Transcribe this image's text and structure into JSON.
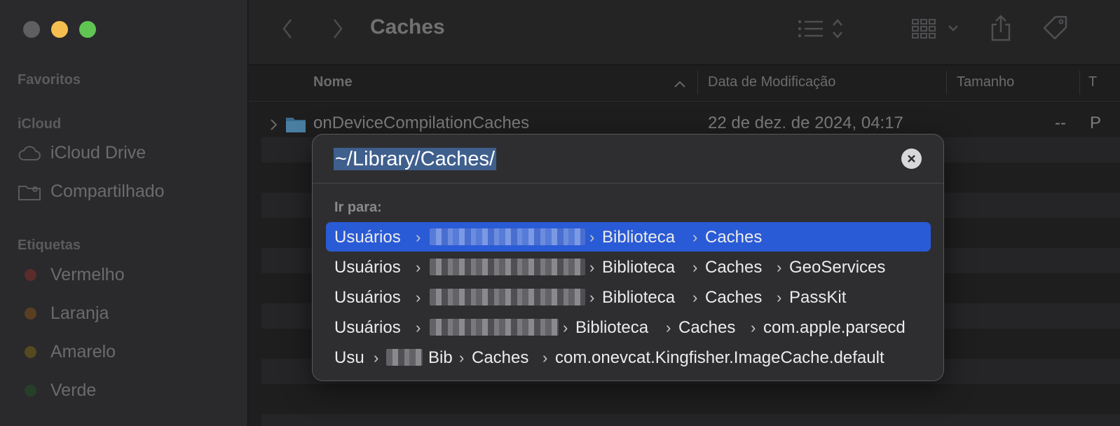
{
  "window": {
    "title": "Caches",
    "traffic_colors": [
      "#5f5f62",
      "#f5bf4f",
      "#61c554"
    ]
  },
  "sidebar": {
    "sections": {
      "favorites": "Favoritos",
      "icloud": "iCloud",
      "tags": "Etiquetas"
    },
    "icloud_items": [
      {
        "label": "iCloud Drive",
        "icon": "cloud-icon"
      },
      {
        "label": "Compartilhado",
        "icon": "shared-folder-icon"
      }
    ],
    "tags": [
      {
        "label": "Vermelho",
        "color": "#5a2c2c"
      },
      {
        "label": "Laranja",
        "color": "#5a3e22"
      },
      {
        "label": "Amarelo",
        "color": "#54491f"
      },
      {
        "label": "Verde",
        "color": "#263f2a"
      }
    ]
  },
  "columns": {
    "name": "Nome",
    "modified": "Data de Modificação",
    "size": "Tamanho",
    "kind_partial": "T"
  },
  "files": [
    {
      "name": "onDeviceCompilationCaches",
      "modified": "22 de dez. de 2024, 04:17",
      "size": "--",
      "kind_partial": "P"
    }
  ],
  "go_to_folder": {
    "path_value": "~/Library/Caches/",
    "section_label": "Ir para:",
    "suggestions": [
      {
        "segments": [
          "Usuários",
          "Biblioteca",
          "Caches"
        ],
        "active": true
      },
      {
        "segments": [
          "Usuários",
          "Biblioteca",
          "Caches",
          "GeoServices"
        ],
        "active": false
      },
      {
        "segments": [
          "Usuários",
          "Biblioteca",
          "Caches",
          "PassKit"
        ],
        "active": false
      },
      {
        "segments": [
          "Usuários",
          "Biblioteca",
          "Caches",
          "com.apple.parsecd"
        ],
        "active": false
      },
      {
        "segments": [
          "Usu",
          "Bib",
          "Caches",
          "com.onevcat.Kingfisher.ImageCache.default"
        ],
        "active": false
      }
    ],
    "accent_color": "#2a5bd6"
  }
}
